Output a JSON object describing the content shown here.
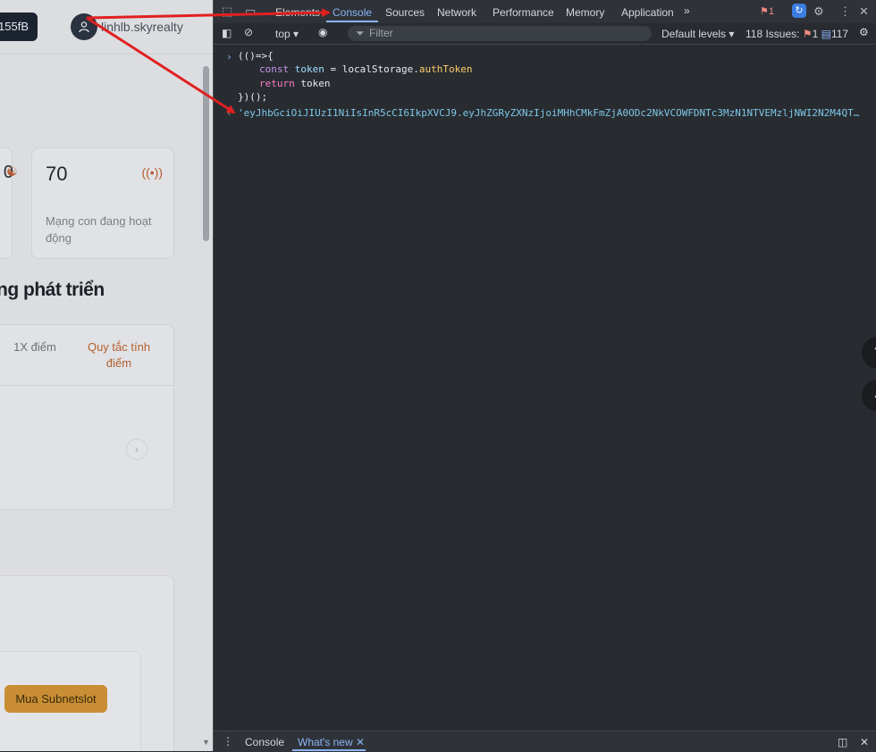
{
  "webpage": {
    "balance": "155fB",
    "username": "linhlb.skyrealty",
    "card_left_value": "0",
    "card_value": "70",
    "card_label": "Mạng con đang hoạt động",
    "section_title": "ng phát triển",
    "table_col1": "1X điểm",
    "table_col2": "Quy tắc tính điểm",
    "buy_button": "Mua Subnetslot"
  },
  "devtools": {
    "tabs": [
      "Elements",
      "Console",
      "Sources",
      "Network",
      "Performance",
      "Memory",
      "Application"
    ],
    "active_tab": "Console",
    "issues_count_red": "1",
    "context": "top",
    "filter_placeholder": "Filter",
    "levels": "Default levels",
    "issues_label": "118 Issues:",
    "issues_err": "1",
    "issues_info": "117",
    "code_lines": [
      "(()=>{",
      "const token = localStorage.authToken",
      "return token",
      "})();"
    ],
    "result_value": "'eyJhbGciOiJIUzI1NiIsInR5cCI6IkpXVCJ9.eyJhZGRyZXNzIjoiMHhCMkFmZjA0ODc2NkVCOWFDNTc3MzN1NTVEMzljNWI2N2M4QTQ1NWZCIiwi…",
    "drawer_tabs": [
      "Console",
      "What's new"
    ],
    "drawer_active": "What's new"
  },
  "annotation": {
    "arrow_color": "#e02020"
  }
}
